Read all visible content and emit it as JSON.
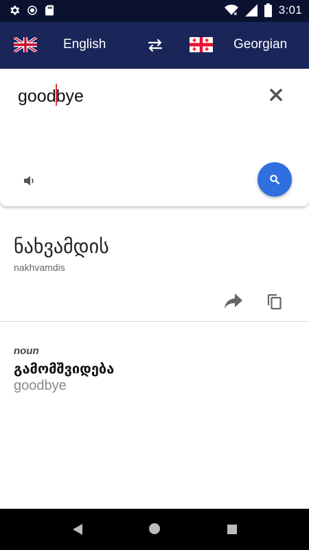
{
  "status_bar": {
    "time": "3:01",
    "left_icons": [
      "gear-icon",
      "sync-icon",
      "sd-card-icon"
    ],
    "right_icons": [
      "wifi-icon",
      "signal-icon",
      "battery-icon"
    ]
  },
  "header": {
    "source_language": "English",
    "target_language": "Georgian",
    "source_flag": "uk-flag-icon",
    "target_flag": "georgia-flag-icon",
    "swap_icon": "swap-icon",
    "background": "#1a2659"
  },
  "input": {
    "text_before_caret": "good",
    "text_after_caret": "bye",
    "clear_icon": "close-icon",
    "speak_icon": "volume-icon",
    "search_icon": "search-icon",
    "search_color": "#2f6fe0"
  },
  "result": {
    "translation": "ნახვამდის",
    "transliteration": "nakhvamdis",
    "share_icon": "share-icon",
    "copy_icon": "copy-icon"
  },
  "dictionary": {
    "part_of_speech": "noun",
    "word": "გამომშვიდება",
    "back_translation": "goodbye"
  },
  "nav_bar": {
    "icons": [
      "back-icon",
      "home-icon",
      "recents-icon"
    ]
  }
}
